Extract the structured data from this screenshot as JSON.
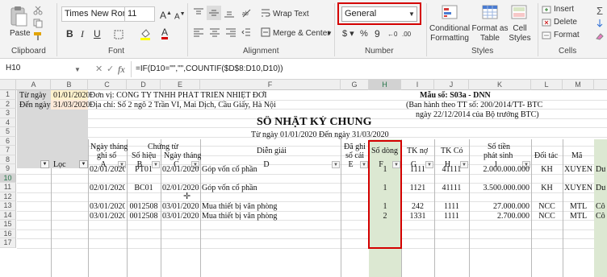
{
  "ribbon": {
    "paste": "Paste",
    "clipboard": "Clipboard",
    "font_name": "Times New Roma",
    "font_size": "11",
    "font_group": "Font",
    "wrap_text": "Wrap Text",
    "merge_center": "Merge & Center",
    "alignment_group": "Alignment",
    "number_format": "General",
    "number_group": "Number",
    "conditional_formatting": [
      "Conditional",
      "Formatting"
    ],
    "format_as_table": [
      "Format as",
      "Table"
    ],
    "cell_styles": [
      "Cell",
      "Styles"
    ],
    "styles_group": "Styles",
    "insert": "Insert",
    "delete": "Delete",
    "format": "Format",
    "cells_group": "Cells",
    "highlight_color": "#d40000"
  },
  "formula_bar": {
    "name_box": "H10",
    "fx": "fx",
    "formula": "=IF(D10=\"\",\"\",COUNTIF($D$8:D10,D10))"
  },
  "columns": [
    "A",
    "B",
    "C",
    "D",
    "E",
    "F",
    "G",
    "H",
    "I",
    "J",
    "K",
    "L",
    "M"
  ],
  "rows": [
    "1",
    "2",
    "3",
    "4",
    "5",
    "6",
    "7",
    "8",
    "9",
    "10",
    "11",
    "12",
    "13",
    "14",
    "15",
    "16",
    "17"
  ],
  "sheet": {
    "tu_ngay_label": "Từ ngày",
    "tu_ngay_value": "01/01/2020",
    "den_ngay_label": "Đến ngày",
    "den_ngay_value": "31/03/2020",
    "don_vi": "Đơn vị: CÔNG TY TNHH PHÁT TRIỂN NHIỆT ĐỚI",
    "dia_chi": "Địa chỉ: Số 2 ngõ 2 Trần VI, Mai Dịch, Cầu Giấy, Hà Nội",
    "mau_so": "Mẫu số: S03a - DNN",
    "ban_hanh": "(Ban hành theo TT số: 200/2014/TT- BTC",
    "ngay_bh": "ngày 22/12/2014 của Bộ trưởng BTC)",
    "title": "SỔ NHẬT KÝ CHUNG",
    "period": "Từ ngày 01/01/2020   Đến ngày 31/03/2020",
    "loc": "Lọc",
    "h_ngay_thang": "Ngày tháng",
    "h_ghi_so": "ghi sổ",
    "h_chung_tu": "Chứng từ",
    "h_so_hieu": "Số hiệu",
    "h_ngay_thang2": "Ngày tháng",
    "h_dien_giai": "Diễn giải",
    "h_da_ghi": "Đã ghi",
    "h_so_cai": "sổ cái",
    "h_so_dong": "Số dòng",
    "h_tk_no": "TK nợ",
    "h_tk_co": "TK Có",
    "h_so_tien": "Số tiền",
    "h_phat_sinh": "phát sinh",
    "h_doi_tac": "Đối tác",
    "h_ma": "Mã",
    "letters": [
      "A",
      "B",
      "C",
      "D",
      "E",
      "F",
      "G",
      "H",
      "1"
    ],
    "data_rows": [
      {
        "row": "9",
        "date": "02/01/2020",
        "so_hieu": "PT01",
        "ngay": "02/01/2020",
        "dien_giai": "Góp vốn cổ phần",
        "so_dong": "1",
        "tk_no": "1111",
        "tk_co": "41111",
        "so_tien": "2.000.000.000",
        "doi_tac": "KH",
        "ma": "XUYEN",
        "extra": "Dươ"
      },
      {
        "row": "11",
        "date": "02/01/2020",
        "so_hieu": "BC01",
        "ngay": "02/01/2020",
        "dien_giai": "Góp vốn cổ phần",
        "so_dong": "1",
        "tk_no": "1121",
        "tk_co": "41111",
        "so_tien": "3.500.000.000",
        "doi_tac": "KH",
        "ma": "XUYEN",
        "extra": "Dươ"
      },
      {
        "row": "13",
        "date": "03/01/2020",
        "so_hieu": "0012508",
        "ngay": "03/01/2020",
        "dien_giai": "Mua thiết bị văn phòng",
        "so_dong": "1",
        "tk_no": "242",
        "tk_co": "1111",
        "so_tien": "27.000.000",
        "doi_tac": "NCC",
        "ma": "MTL",
        "extra": "Côn"
      },
      {
        "row": "14",
        "date": "03/01/2020",
        "so_hieu": "0012508",
        "ngay": "03/01/2020",
        "dien_giai": "Mua thiết bị văn phòng",
        "so_dong": "2",
        "tk_no": "1331",
        "tk_co": "1111",
        "so_tien": "2.700.000",
        "doi_tac": "NCC",
        "ma": "MTL",
        "extra": "Côn"
      }
    ]
  }
}
